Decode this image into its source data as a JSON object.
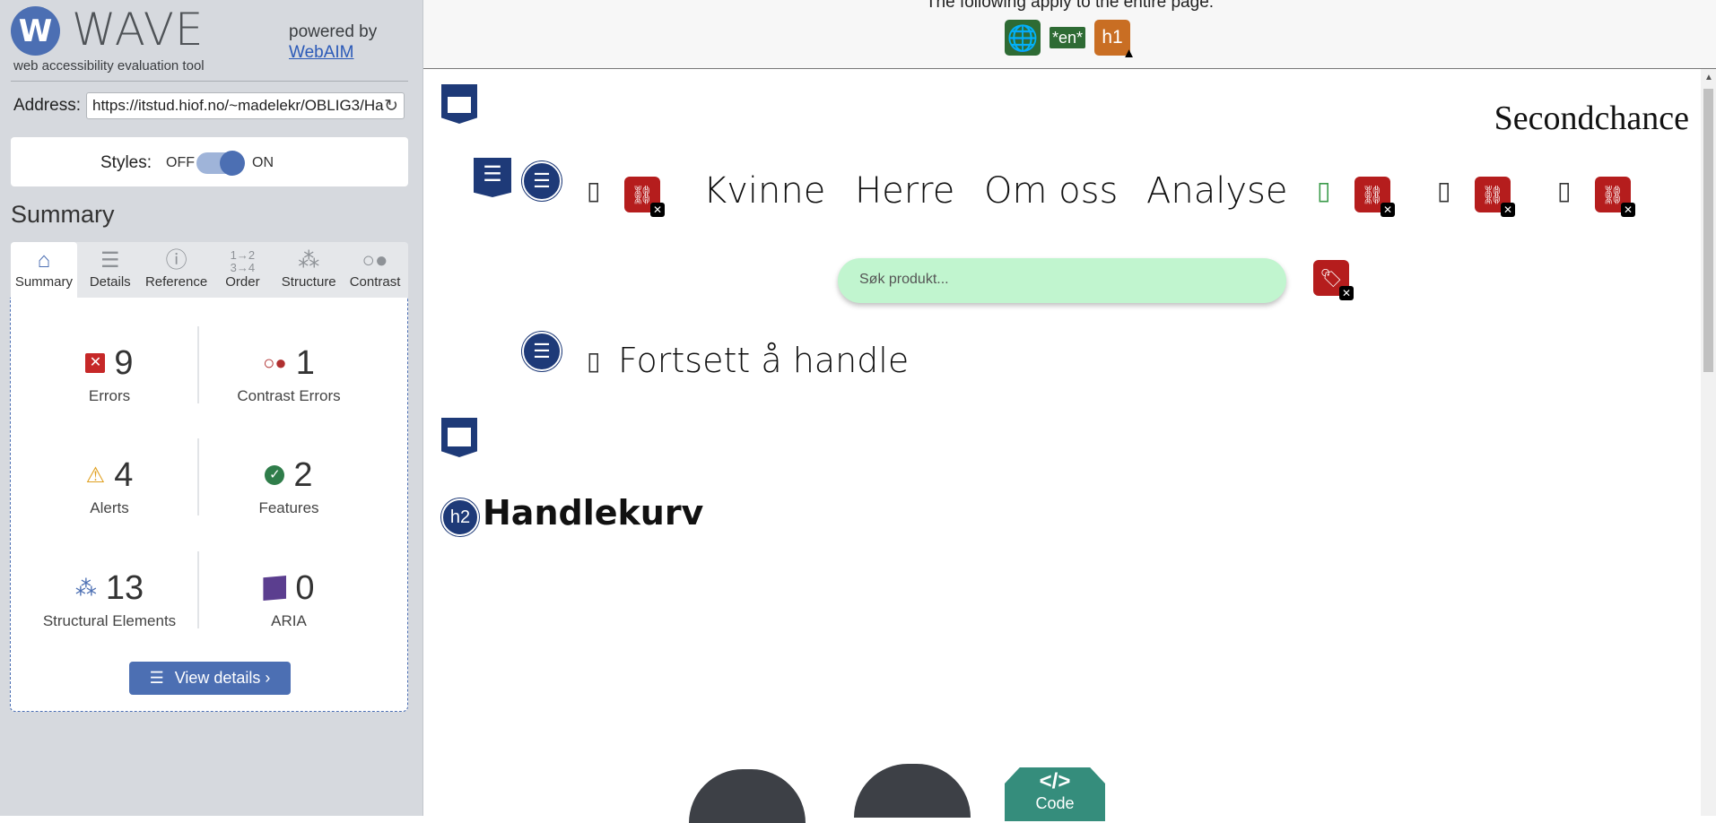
{
  "sidebar": {
    "logo_letter": "W",
    "logo_word": "WAVE",
    "tagline": "web accessibility evaluation tool",
    "powered_by": "powered by",
    "webaim_link": "WebAIM",
    "address_label": "Address:",
    "address_value": "https://itstud.hiof.no/~madelekr/OBLIG3/Ha",
    "styles_label": "Styles:",
    "styles_off": "OFF",
    "styles_on": "ON",
    "summary_title": "Summary",
    "tabs": [
      {
        "label": "Summary",
        "icon": "home-icon"
      },
      {
        "label": "Details",
        "icon": "list-icon"
      },
      {
        "label": "Reference",
        "icon": "info-icon"
      },
      {
        "label": "Order",
        "icon": "order-icon"
      },
      {
        "label": "Structure",
        "icon": "structure-icon"
      },
      {
        "label": "Contrast",
        "icon": "contrast-icon"
      }
    ],
    "stats": {
      "errors": {
        "value": "9",
        "label": "Errors",
        "color": "#c62828"
      },
      "contrast": {
        "value": "1",
        "label": "Contrast Errors",
        "color": "#b03030"
      },
      "alerts": {
        "value": "4",
        "label": "Alerts",
        "color": "#e0a020"
      },
      "features": {
        "value": "2",
        "label": "Features",
        "color": "#2f7d4a"
      },
      "structural": {
        "value": "13",
        "label": "Structural Elements",
        "color": "#4c6fb3"
      },
      "aria": {
        "value": "0",
        "label": "ARIA",
        "color": "#5b3e8f"
      }
    },
    "view_details": "View details ›"
  },
  "page": {
    "top_note": "The following apply to the entire page:",
    "lang_badge": "*en*",
    "h1_badge": "h1",
    "brand": "Secondchance",
    "nav": [
      "Kvinne",
      "Herre",
      "Om oss",
      "Analyse"
    ],
    "search_placeholder": "Søk produkt...",
    "continue_text": "Fortsett å handle",
    "h2_badge": "h2",
    "cart_heading": "Handlekurv",
    "code_badge_symbol": "</>",
    "code_badge_label": "Code"
  }
}
